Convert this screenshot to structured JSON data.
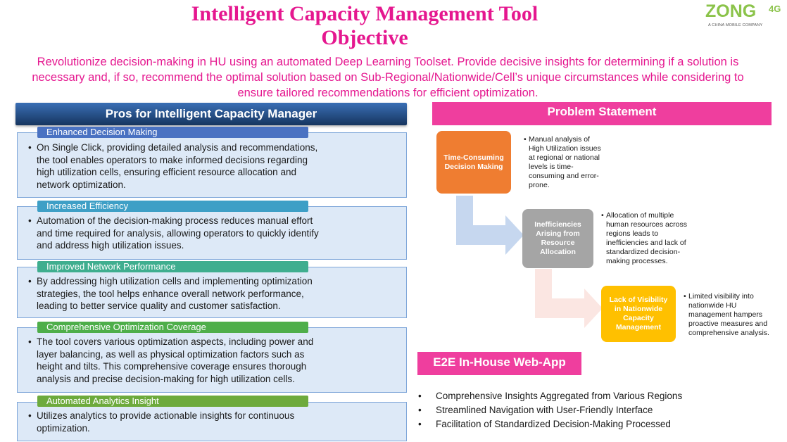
{
  "title": {
    "line1": "Intelligent Capacity Management Tool",
    "line2": "Objective"
  },
  "logo": {
    "word": "ZONG",
    "suffix": "4G",
    "tagline": "A CHINA MOBILE COMPANY"
  },
  "objective": {
    "line1": "Revolutionize decision-making in HU using an automated Deep Learning Toolset. Provide decisive insights for determining if a solution is",
    "line2": "necessary and, if so, recommend the optimal solution based on Sub-Regional/Nationwide/Cell’s  unique circumstances  while considering to",
    "line3": "ensure tailored recommendations for efficient optimization."
  },
  "pros": {
    "header": "Pros for Intelligent Capacity Manager",
    "items": [
      {
        "tag": "Enhanced Decision Making",
        "color": "#4a72c2",
        "lines": [
          "On Single Click, providing detailed analysis and recommendations,",
          "the tool enables operators to make informed decisions regarding",
          "high utilization cells, ensuring efficient resource allocation and",
          "network optimization."
        ]
      },
      {
        "tag": "Increased Efficiency",
        "color": "#3e9fc6",
        "lines": [
          "Automation of the decision-making process reduces manual effort",
          "and time required for analysis, allowing operators to quickly identify",
          "and address high utilization issues."
        ]
      },
      {
        "tag": "Improved Network Performance",
        "color": "#3fae8f",
        "lines": [
          "By addressing high utilization cells and implementing optimization",
          "strategies, the tool helps enhance overall network performance,",
          "leading to better service quality and customer satisfaction."
        ]
      },
      {
        "tag": "Comprehensive Optimization Coverage",
        "color": "#4eae4a",
        "lines": [
          "The tool covers various optimization aspects, including power and",
          "layer balancing, as well as physical optimization factors such as",
          "height and tilts. This comprehensive coverage ensures thorough",
          "analysis and precise decision-making for high utilization cells."
        ]
      },
      {
        "tag": "Automated Analytics Insight",
        "color": "#6daa3c",
        "lines": [
          "Utilizes analytics to provide actionable insights for continuous",
          "optimization."
        ]
      }
    ]
  },
  "problem": {
    "header": "Problem Statement",
    "nodes": [
      {
        "label": [
          "Time-Consuming",
          "Decision Making"
        ],
        "color": "#ef7d31",
        "desc": [
          "Manual analysis of",
          "High Utilization  issues",
          "at regional or national",
          "levels is time-",
          "consuming and error-",
          "prone."
        ]
      },
      {
        "label": [
          "Inefficiencies",
          "Arising from",
          "Resource",
          "Allocation"
        ],
        "color": "#a5a5a5",
        "desc": [
          "Allocation of multiple",
          "human resources across",
          "regions leads to",
          "inefficiencies and lack of",
          "standardized decision-",
          "making processes."
        ]
      },
      {
        "label": [
          "Lack of Visibility",
          "in Nationwide",
          "Capacity",
          "Management"
        ],
        "color": "#ffc000",
        "desc": [
          "Limited visibility into",
          "nationwide HU",
          "management hampers",
          "proactive measures and",
          "comprehensive analysis."
        ]
      }
    ]
  },
  "e2e": {
    "header": "E2E In-House Web-App",
    "items": [
      "Comprehensive Insights Aggregated from Various Regions",
      "Streamlined Navigation with User-Friendly Interface",
      "Facilitation of Standardized Decision-Making Processed"
    ]
  },
  "bullet": "•"
}
